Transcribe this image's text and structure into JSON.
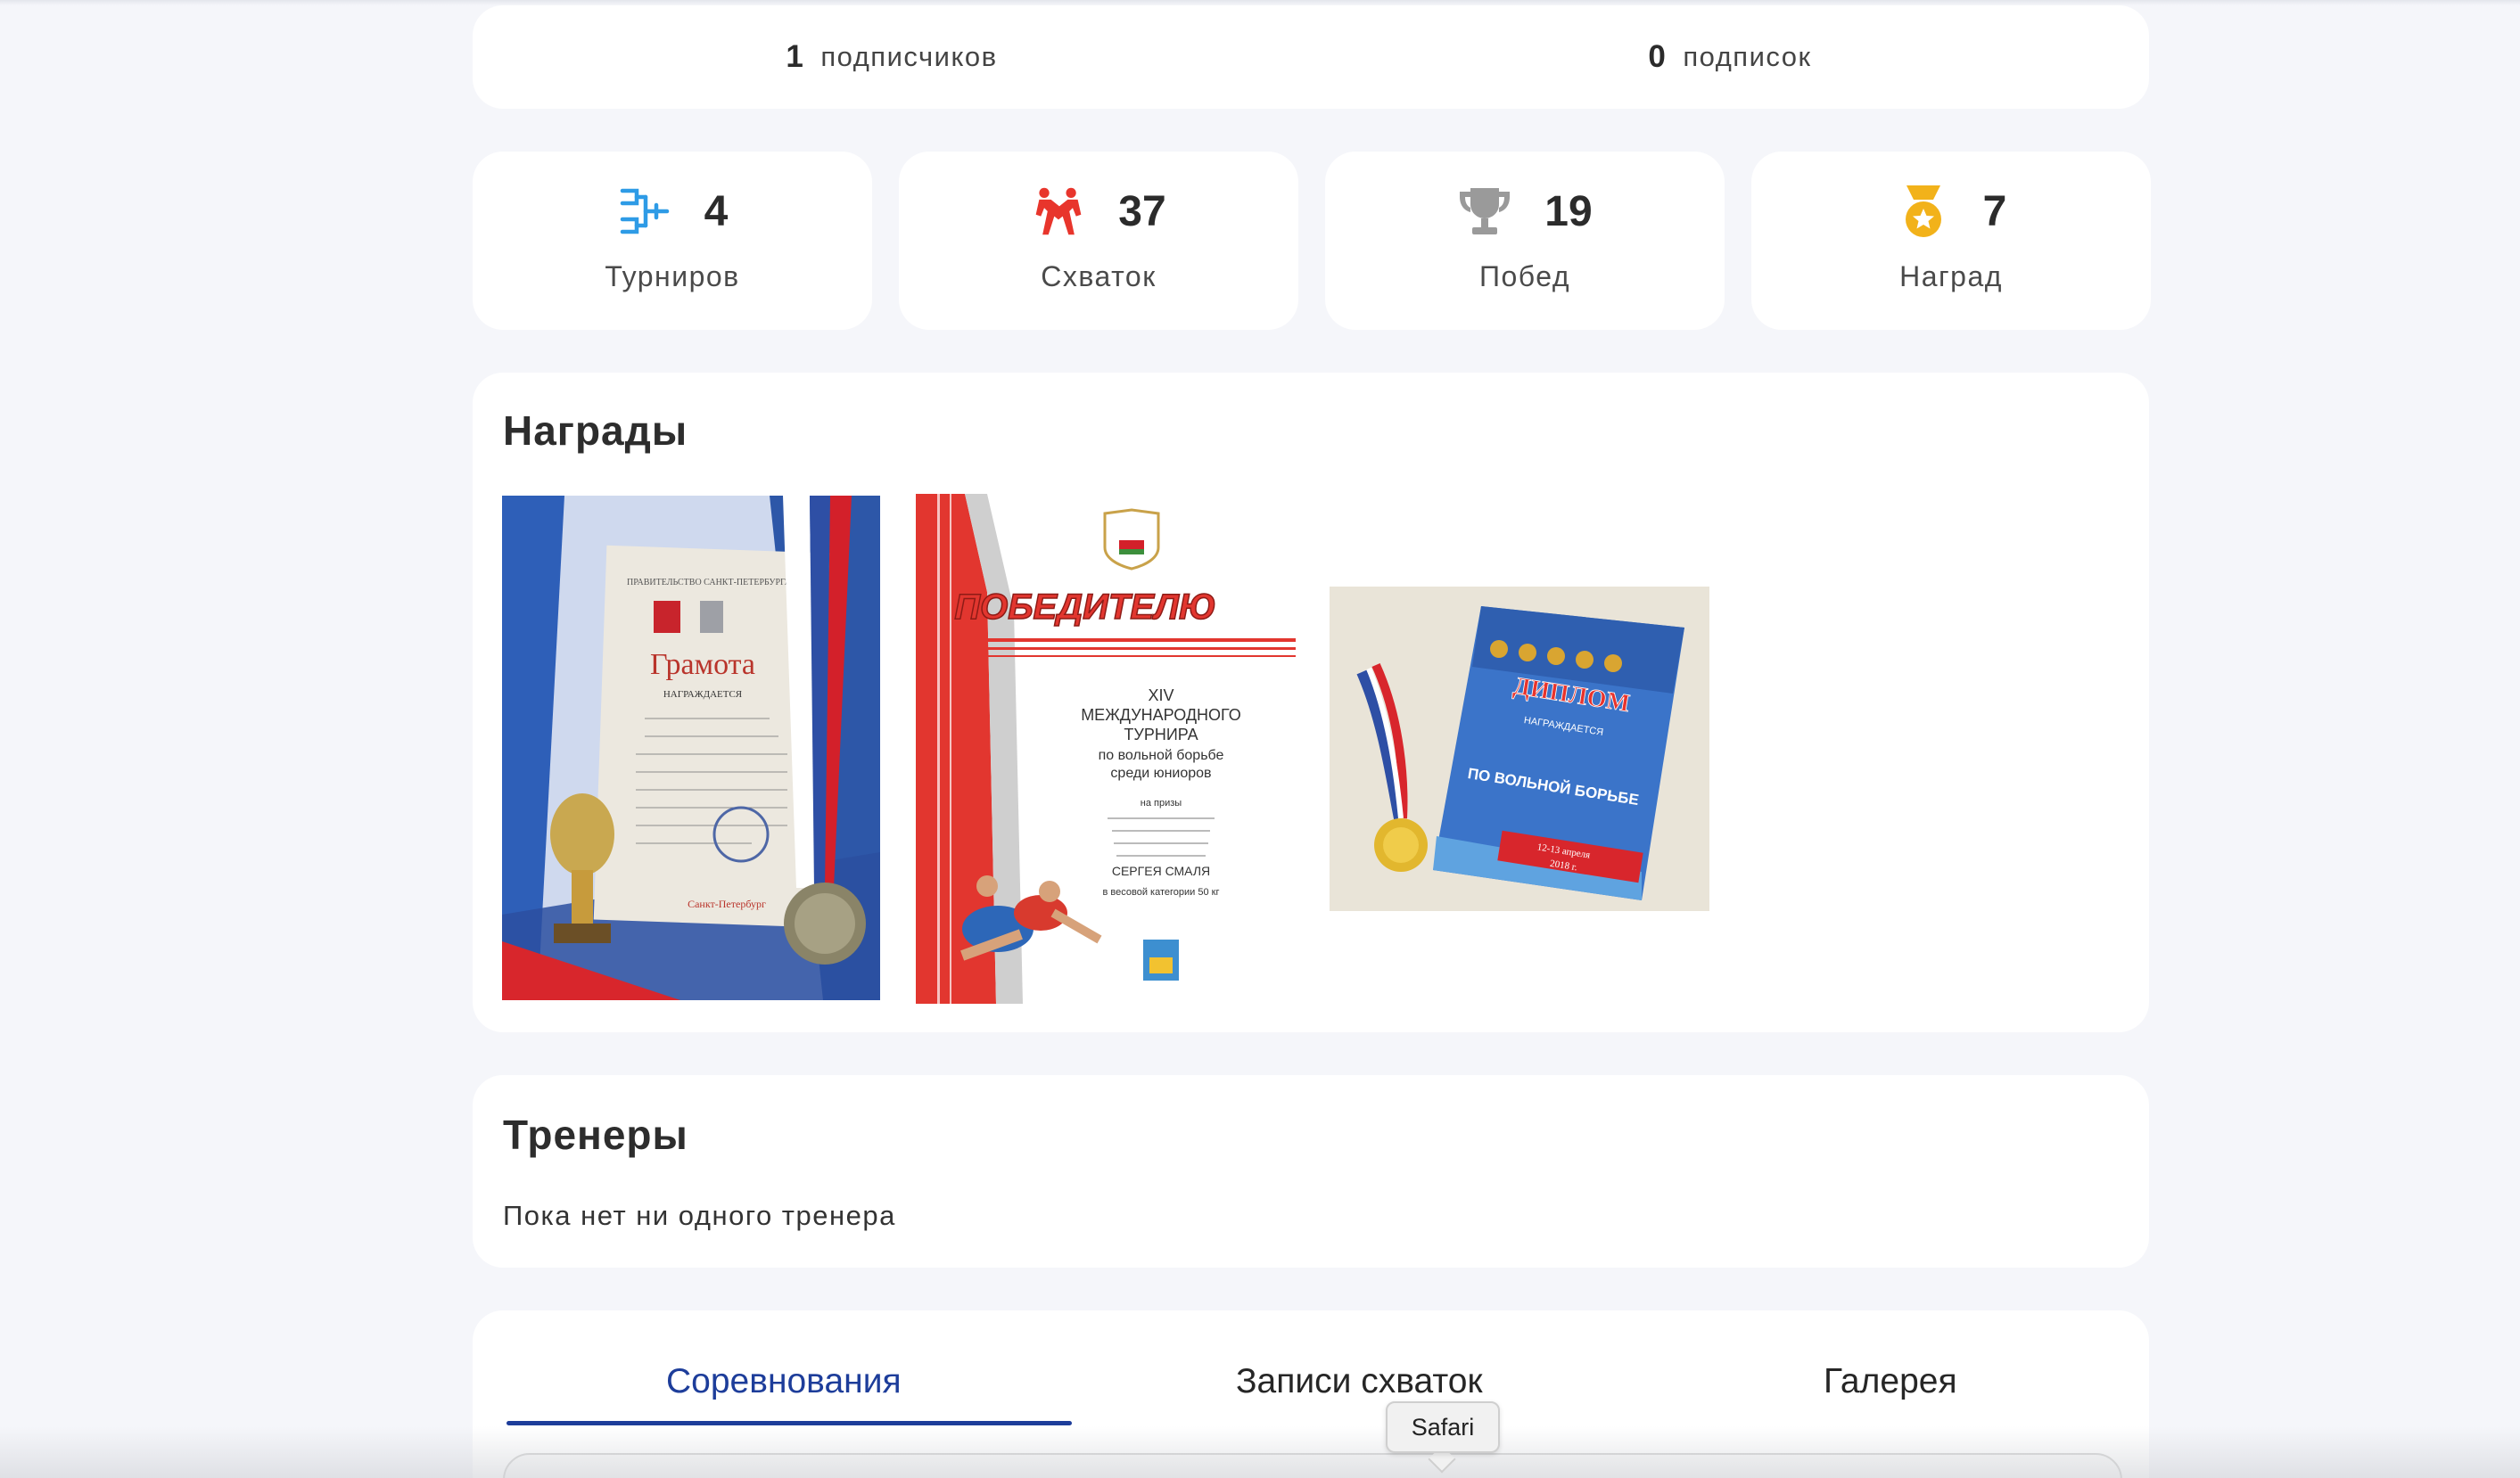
{
  "followers": {
    "count": "1",
    "label": "подписчиков"
  },
  "following": {
    "count": "0",
    "label": "подписок"
  },
  "stats": [
    {
      "icon": "bracket-icon",
      "value": "4",
      "label": "Турниров",
      "color": "#2e9be6"
    },
    {
      "icon": "wrestlers-icon",
      "value": "37",
      "label": "Схваток",
      "color": "#e8352c"
    },
    {
      "icon": "trophy-icon",
      "value": "19",
      "label": "Побед",
      "color": "#9a9a9a"
    },
    {
      "icon": "medal-icon",
      "value": "7",
      "label": "Наград",
      "color": "#f2b21a"
    }
  ],
  "awards": {
    "title": "Награды",
    "items": [
      {
        "heading": "Грамота",
        "subheading": "НАГРАЖДАЕТСЯ",
        "footer": "Санкт-Петербург"
      },
      {
        "heading": "ПОБЕДИТЕЛЮ",
        "line1": "XIV",
        "line2": "МЕЖДУНАРОДНОГО",
        "line3": "ТУРНИРА",
        "line4": "по вольной борьбе",
        "line5": "среди юниоров",
        "line6": "на призы",
        "line7": "СЕРГЕЯ СМАЛЯ",
        "line8": "в весовой категории 50 кг"
      },
      {
        "heading": "ДИПЛОМ",
        "subheading": "НАГРАЖДАЕТСЯ",
        "line1": "ПО ВОЛЬНОЙ БОРЬБЕ",
        "line2": "12-13 апреля",
        "line3": "2018 г."
      }
    ]
  },
  "trainers": {
    "title": "Тренеры",
    "empty_text": "Пока нет ни одного тренера"
  },
  "tabs": {
    "competitions": "Соревнования",
    "fight_records": "Записи схваток",
    "gallery": "Галерея",
    "active_color": "#1d3d9a"
  },
  "tooltip": {
    "text": "Safari"
  }
}
